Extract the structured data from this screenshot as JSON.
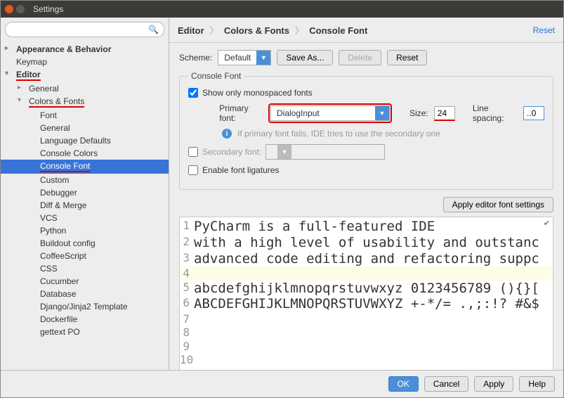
{
  "window": {
    "title": "Settings"
  },
  "search": {
    "placeholder": ""
  },
  "tree": {
    "appearance": "Appearance & Behavior",
    "keymap": "Keymap",
    "editor": "Editor",
    "general": "General",
    "colors_fonts": "Colors & Fonts",
    "items": {
      "font": "Font",
      "general2": "General",
      "lang_defaults": "Language Defaults",
      "console_colors": "Console Colors",
      "console_font": "Console Font",
      "custom": "Custom",
      "debugger": "Debugger",
      "diff_merge": "Diff & Merge",
      "vcs": "VCS",
      "python": "Python",
      "buildout": "Buildout config",
      "coffeescript": "CoffeeScript",
      "css": "CSS",
      "cucumber": "Cucumber",
      "database": "Database",
      "django": "Django/Jinja2 Template",
      "dockerfile": "Dockerfile",
      "gettext": "gettext PO"
    }
  },
  "breadcrumb": {
    "a": "Editor",
    "b": "Colors & Fonts",
    "c": "Console Font",
    "reset": "Reset"
  },
  "scheme": {
    "label": "Scheme:",
    "value": "Default",
    "save_as": "Save As...",
    "delete": "Delete",
    "reset": "Reset"
  },
  "console_font": {
    "legend": "Console Font",
    "show_mono": "Show only monospaced fonts",
    "primary_label": "Primary font:",
    "primary_value": "DialogInput",
    "size_label": "Size:",
    "size_value": "24",
    "line_spacing_label": "Line spacing:",
    "line_spacing_value": "..0",
    "fallback_msg": "If primary font fails, IDE tries to use the secondary one",
    "secondary_label": "Secondary font:",
    "ligatures": "Enable font ligatures",
    "apply_editor": "Apply editor font settings"
  },
  "preview": {
    "lines": [
      "PyCharm is a full-featured IDE",
      "with a high level of usability and outstanc",
      "advanced code editing and refactoring suppc",
      "",
      "abcdefghijklmnopqrstuvwxyz 0123456789 (){}[",
      "ABCDEFGHIJKLMNOPQRSTUVWXYZ +-*/= .,;:!? #&$",
      "",
      "",
      "",
      ""
    ]
  },
  "footer": {
    "ok": "OK",
    "cancel": "Cancel",
    "apply": "Apply",
    "help": "Help"
  }
}
